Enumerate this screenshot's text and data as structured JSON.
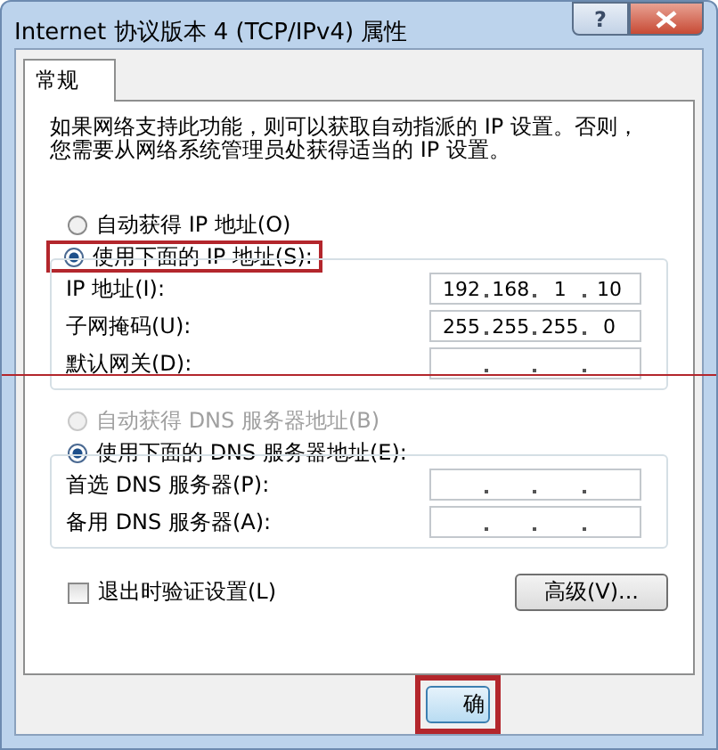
{
  "window": {
    "title": "Internet 协议版本 4 (TCP/IPv4) 属性",
    "help": "?"
  },
  "tabs": [
    {
      "label": "常规",
      "selected": true
    }
  ],
  "description": "如果网络支持此功能，则可以获取自动指派的 IP 设置。否则，您需要从网络系统管理员处获得适当的 IP 设置。",
  "ip_mode": [
    {
      "label": "自动获得 IP 地址(O)",
      "selected": false,
      "disabled": false,
      "highlighted": false
    },
    {
      "label": "使用下面的 IP 地址(S):",
      "selected": true,
      "disabled": false,
      "highlighted": true
    }
  ],
  "ip_fields": [
    {
      "label": "IP 地址(I):",
      "octets": [
        "192",
        "168",
        "1",
        "10"
      ]
    },
    {
      "label": "子网掩码(U):",
      "octets": [
        "255",
        "255",
        "255",
        "0"
      ]
    },
    {
      "label": "默认网关(D):"
    }
  ],
  "annotation_line": true,
  "dns_mode": [
    {
      "label": "自动获得 DNS 服务器地址(B)",
      "selected": false,
      "disabled": true,
      "highlighted": false
    },
    {
      "label": "使用下面的 DNS 服务器地址(E):",
      "selected": true,
      "disabled": false,
      "highlighted": false
    }
  ],
  "dns_fields": [
    {
      "label": "首选 DNS 服务器(P):"
    },
    {
      "label": "备用 DNS 服务器(A):"
    }
  ],
  "validate": {
    "label": "退出时验证设置(L)",
    "checked": false
  },
  "advanced_button": "高级(V)...",
  "ok_button": {
    "label": "确",
    "highlighted": true
  }
}
